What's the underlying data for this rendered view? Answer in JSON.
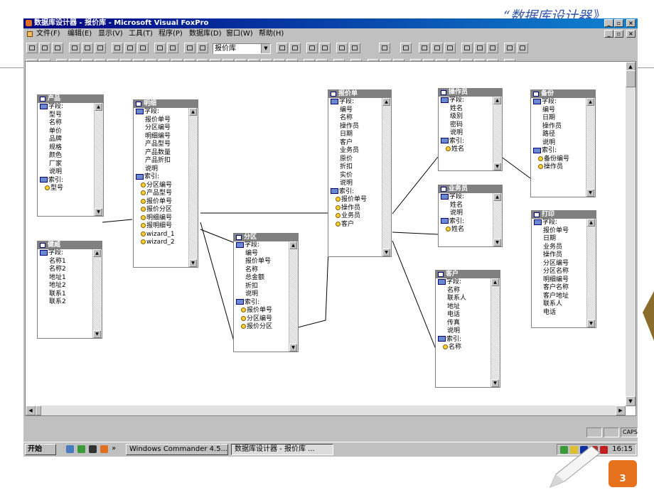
{
  "slide": {
    "title": "“数据库设计器》",
    "page_number": "3"
  },
  "window": {
    "title": "数据库设计器 - 报价库 - Microsoft Visual FoxPro",
    "menu": [
      "文件(F)",
      "编辑(E)",
      "显示(V)",
      "工具(T)",
      "程序(P)",
      "数据库(D)",
      "窗口(W)",
      "帮助(H)"
    ],
    "database_combo": "报价库",
    "status_caps": "CAPS"
  },
  "labels": {
    "fields": "字段:",
    "indexes": "索引:"
  },
  "tables": {
    "chanpin": {
      "title": "产品",
      "fields": [
        "型号",
        "名称",
        "单价",
        "品牌",
        "规格",
        "颜色",
        "厂家",
        "说明"
      ],
      "indexes": [
        "型号"
      ]
    },
    "mingxi": {
      "title": "明细",
      "fields": [
        "报价单号",
        "分区编号",
        "明细编号",
        "产品型号",
        "产品数量",
        "产品折扣",
        "说明"
      ],
      "indexes": [
        "分区编号",
        "产品型号",
        "报价单号",
        "报价分区",
        "明细编号",
        "报明细号",
        "wizard_1",
        "wizard_2"
      ]
    },
    "jianwei": {
      "title": "健威",
      "fields": [
        "名称1",
        "名称2",
        "地址1",
        "地址2",
        "联系1",
        "联系2"
      ],
      "indexes": []
    },
    "fenqu": {
      "title": "分区",
      "fields": [
        "编号",
        "报价单号",
        "名称",
        "总金额",
        "折扣",
        "说明"
      ],
      "indexes": [
        "报价单号",
        "分区编号",
        "报价分区"
      ]
    },
    "baojiadan": {
      "title": "报价单",
      "fields": [
        "编号",
        "名称",
        "操作员",
        "日期",
        "客户",
        "业务员",
        "原价",
        "折扣",
        "实价",
        "说明"
      ],
      "indexes": [
        "报价单号",
        "操作员",
        "业务员",
        "客户"
      ]
    },
    "caozuoyuan": {
      "title": "操作员",
      "fields": [
        "姓名",
        "级别",
        "密码",
        "说明"
      ],
      "indexes": [
        "姓名"
      ]
    },
    "yewuyuan": {
      "title": "业务员",
      "fields": [
        "姓名",
        "说明"
      ],
      "indexes": [
        "姓名"
      ]
    },
    "kehu": {
      "title": "客户",
      "fields": [
        "名称",
        "联系人",
        "地址",
        "电话",
        "传真",
        "说明"
      ],
      "indexes": [
        "名称"
      ]
    },
    "beifen": {
      "title": "备份",
      "fields": [
        "编号",
        "日期",
        "操作员",
        "路径",
        "说明"
      ],
      "indexes": [
        "备份编号",
        "操作员"
      ]
    },
    "dayin": {
      "title": "打印",
      "fields": [
        "报价单号",
        "日期",
        "业务员",
        "操作员",
        "分区编号",
        "分区名称",
        "明细编号",
        "客户名称",
        "客户地址",
        "联系人",
        "电话"
      ],
      "indexes": []
    }
  },
  "taskbar": {
    "start": "开始",
    "task_commander": "Windows Commander 4.5...",
    "task_designer": "数据库设计器 - 报价库 ...",
    "clock": "16:15"
  }
}
